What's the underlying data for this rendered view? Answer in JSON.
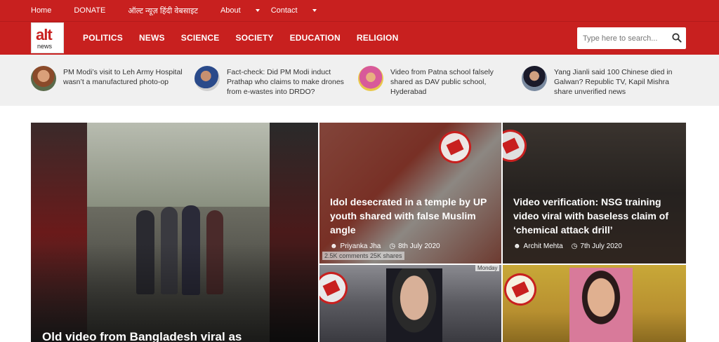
{
  "topbar": {
    "links": [
      {
        "label": "Home"
      },
      {
        "label": "DONATE"
      },
      {
        "label": "ऑल्ट न्यूज़ हिंदी वेबसाइट"
      },
      {
        "label": "About",
        "dropdown": true
      },
      {
        "label": "Contact",
        "dropdown": true
      }
    ]
  },
  "logo": {
    "alt": "alt",
    "news": "news"
  },
  "nav": [
    "POLITICS",
    "NEWS",
    "SCIENCE",
    "SOCIETY",
    "EDUCATION",
    "RELIGION"
  ],
  "search": {
    "placeholder": "Type here to search..."
  },
  "trending": [
    {
      "title": "PM Modi’s visit to Leh Army Hospital wasn’t a manufactured photo-op"
    },
    {
      "title": "Fact-check: Did PM Modi induct Prathap who claims to make drones from e-wastes into DRDO?"
    },
    {
      "title": "Video from Patna school falsely shared as DAV public school, Hyderabad"
    },
    {
      "title": "Yang Jianli said 100 Chinese died in Galwan? Republic TV, Kapil Mishra share unverified news"
    }
  ],
  "featured": {
    "main": {
      "title": "Old video from Bangladesh viral as"
    },
    "tile2": {
      "title": "Idol desecrated in a temple by UP youth shared with false Muslim angle",
      "author": "Priyanka Jha",
      "date": "8th July 2020",
      "overlay": "2.5K comments  25K shares"
    },
    "tile3": {
      "title": "Video verification: NSG training video viral with baseless claim of ‘chemical attack drill’",
      "author": "Archit Mehta",
      "date": "7th July 2020"
    },
    "tile4": {
      "label": "Monday"
    }
  },
  "colors": {
    "brand_red": "#c8201f",
    "trending_bg": "#f0f0f0"
  }
}
